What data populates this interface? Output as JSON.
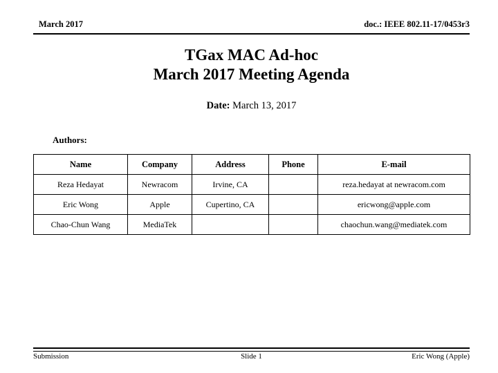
{
  "header": {
    "left": "March 2017",
    "right": "doc.: IEEE 802.11-17/0453r3"
  },
  "title": {
    "line1": "TGax MAC Ad-hoc",
    "line2": "March 2017 Meeting Agenda"
  },
  "date": {
    "label": "Date:",
    "value": " March 13, 2017"
  },
  "authors": {
    "label": "Authors:",
    "columns": [
      "Name",
      "Company",
      "Address",
      "Phone",
      "E-mail"
    ],
    "rows": [
      {
        "name": "Reza Hedayat",
        "company": "Newracom",
        "address": "Irvine, CA",
        "phone": "",
        "email": "reza.hedayat at newracom.com"
      },
      {
        "name": "Eric Wong",
        "company": "Apple",
        "address": "Cupertino, CA",
        "phone": "",
        "email": "ericwong@apple.com"
      },
      {
        "name": "Chao-Chun Wang",
        "company": "MediaTek",
        "address": "",
        "phone": "",
        "email": "chaochun.wang@mediatek.com"
      }
    ]
  },
  "footer": {
    "left": "Submission",
    "center": "Slide 1",
    "right": "Eric Wong (Apple)"
  }
}
